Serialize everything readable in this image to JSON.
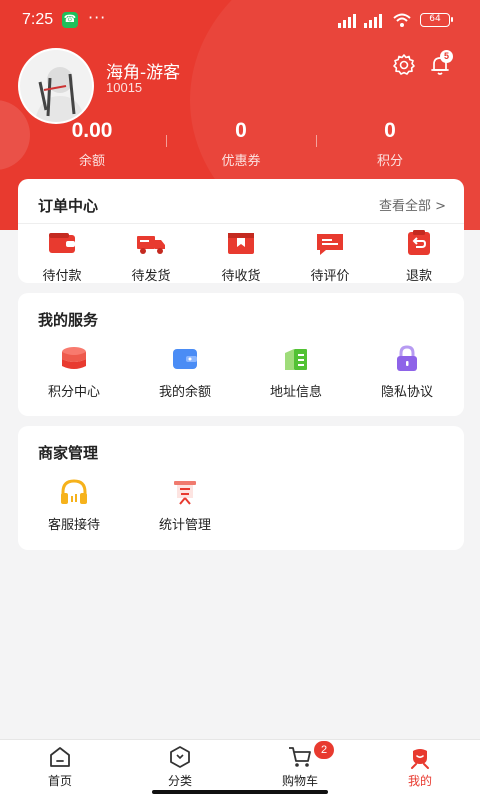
{
  "status_bar": {
    "time": "7:25",
    "battery": "64"
  },
  "profile": {
    "nickname": "海角-游客",
    "user_id": "10015",
    "notification_count": "5"
  },
  "stats": [
    {
      "value": "0.00",
      "label": "余额"
    },
    {
      "value": "0",
      "label": "优惠券"
    },
    {
      "value": "0",
      "label": "积分"
    }
  ],
  "orders": {
    "title": "订单中心",
    "view_all": "查看全部 >",
    "items": [
      {
        "label": "待付款",
        "icon": "wallet-icon"
      },
      {
        "label": "待发货",
        "icon": "truck-icon"
      },
      {
        "label": "待收货",
        "icon": "package-icon"
      },
      {
        "label": "待评价",
        "icon": "comment-icon"
      },
      {
        "label": "退款",
        "icon": "refund-icon"
      }
    ]
  },
  "services": {
    "title": "我的服务",
    "items": [
      {
        "label": "积分中心",
        "icon": "coins-icon"
      },
      {
        "label": "我的余额",
        "icon": "wallet-card-icon"
      },
      {
        "label": "地址信息",
        "icon": "address-icon"
      },
      {
        "label": "隐私协议",
        "icon": "lock-icon"
      }
    ]
  },
  "merchant": {
    "title": "商家管理",
    "items": [
      {
        "label": "客服接待",
        "icon": "headset-icon"
      },
      {
        "label": "统计管理",
        "icon": "statistics-icon"
      }
    ]
  },
  "bottom_nav": {
    "items": [
      {
        "label": "首页",
        "icon": "home-icon"
      },
      {
        "label": "分类",
        "icon": "category-icon"
      },
      {
        "label": "购物车",
        "icon": "cart-icon"
      },
      {
        "label": "我的",
        "icon": "profile-icon"
      }
    ],
    "cart_count": "2",
    "active_index": 3
  },
  "colors": {
    "brand": "#e83a2f",
    "background": "#f4f4f5"
  }
}
